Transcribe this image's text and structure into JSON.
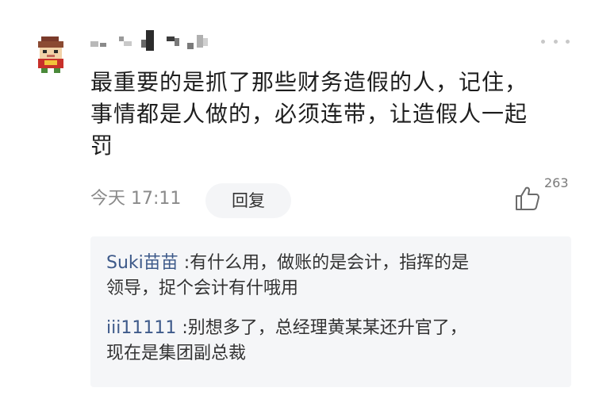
{
  "comment": {
    "author_name": "",
    "text_lines": [
      "最重要的是抓了那些财务造假的人，记住，",
      "事情都是人做的，必须连带，让造假人一起",
      "罚"
    ],
    "time": "今天 17:11",
    "reply_button_label": "回复",
    "like_count": "263"
  },
  "replies": [
    {
      "author": "Suki苗苗",
      "line1": " :有什么用，做账的是会计，指挥的是",
      "line2": "领导，捉个会计有什哦用"
    },
    {
      "author": "iii11111",
      "line1": " :别想多了，总经理黄某某还升官了，",
      "line2": "现在是集团副总裁"
    }
  ],
  "colors": {
    "author_link": "#3e5a8a",
    "reply_box_bg": "#f5f6f8",
    "muted_text": "#8a8a8a"
  },
  "icons": {
    "avatar": "cartoon-avatar",
    "more": "more-dots-icon",
    "like": "thumbs-up-icon"
  }
}
